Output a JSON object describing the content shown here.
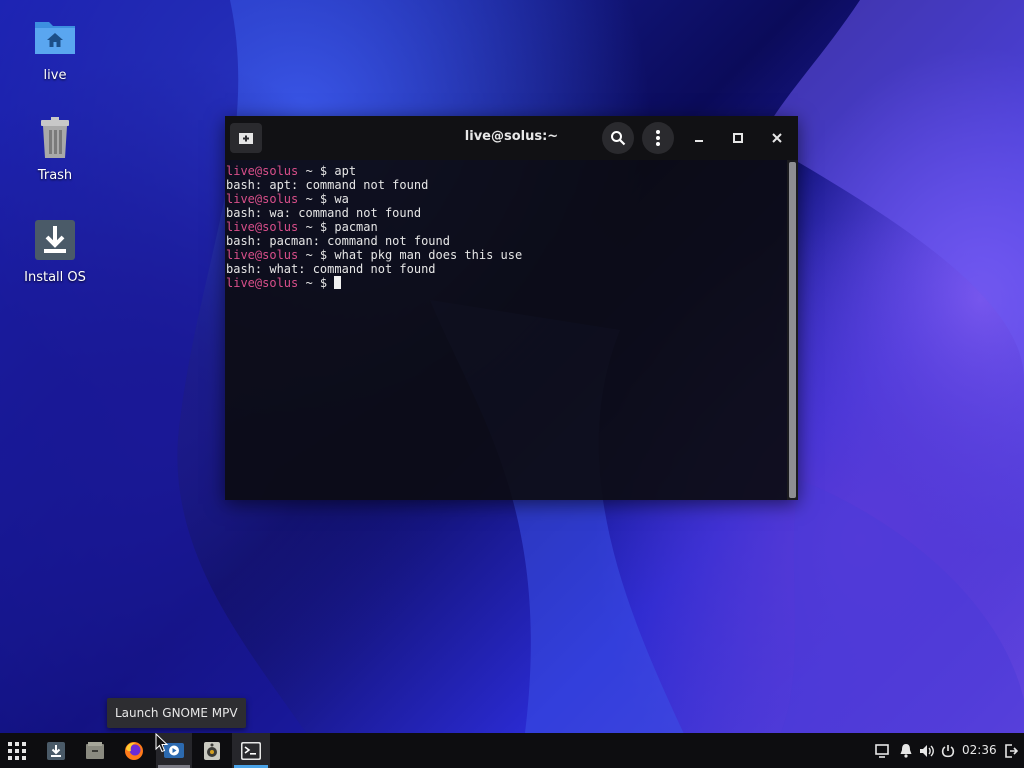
{
  "desktop": {
    "icons": [
      {
        "label": "live",
        "icon": "home-folder-icon"
      },
      {
        "label": "Trash",
        "icon": "trash-icon"
      },
      {
        "label": "Install OS",
        "icon": "install-download-icon"
      }
    ]
  },
  "terminal": {
    "title": "live@solus:~",
    "prompt_user": "live@solus",
    "prompt_rest": " ~ $ ",
    "lines": [
      {
        "type": "prompt",
        "text": "apt"
      },
      {
        "type": "output",
        "text": "bash: apt: command not found"
      },
      {
        "type": "prompt",
        "text": "wa"
      },
      {
        "type": "output",
        "text": "bash: wa: command not found"
      },
      {
        "type": "prompt",
        "text": "pacman"
      },
      {
        "type": "output",
        "text": "bash: pacman: command not found"
      },
      {
        "type": "prompt",
        "text": "what pkg man does this use"
      },
      {
        "type": "output",
        "text": "bash: what: command not found"
      },
      {
        "type": "prompt",
        "text": "",
        "cursor": true
      }
    ],
    "buttons": {
      "new_tab": "new-tab-icon",
      "search": "search-icon",
      "menu": "kebab-menu-icon",
      "minimize": "minimize-icon",
      "maximize": "maximize-icon",
      "close": "close-icon"
    }
  },
  "tooltip": {
    "text": "Launch GNOME MPV"
  },
  "taskbar": {
    "apps": [
      {
        "name": "app-menu",
        "icon": "app-grid-icon"
      },
      {
        "name": "installer",
        "icon": "install-download-icon"
      },
      {
        "name": "files",
        "icon": "files-icon"
      },
      {
        "name": "firefox",
        "icon": "firefox-icon"
      },
      {
        "name": "gnome-mpv",
        "icon": "mpv-icon",
        "active": true
      },
      {
        "name": "rhythmbox",
        "icon": "speaker-icon"
      },
      {
        "name": "terminal",
        "icon": "terminal-icon",
        "active": true
      }
    ],
    "tray": [
      "notification-area-icon",
      "bell-icon",
      "volume-icon",
      "power-icon"
    ],
    "clock": "02:36",
    "logout": "logout-icon"
  },
  "colors": {
    "prompt_user": "#d94f8a",
    "terminal_active_indicator": "#4aa3e8",
    "taskbar_bg": "#0d0d10"
  }
}
